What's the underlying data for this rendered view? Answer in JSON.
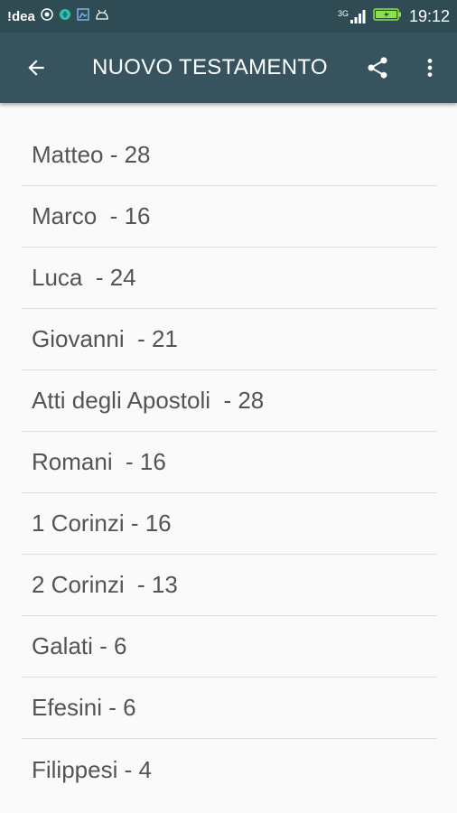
{
  "status_bar": {
    "carrier": "!dea",
    "network": "3G",
    "time": "19:12"
  },
  "toolbar": {
    "title": "NUOVO TESTAMENTO",
    "back_icon": "arrow-back-icon",
    "share_icon": "share-icon",
    "more_icon": "more-vert-icon"
  },
  "books": [
    {
      "label": "Matteo - 28"
    },
    {
      "label": "Marco  - 16"
    },
    {
      "label": "Luca  - 24"
    },
    {
      "label": "Giovanni  - 21"
    },
    {
      "label": "Atti degli Apostoli  - 28"
    },
    {
      "label": "Romani  - 16"
    },
    {
      "label": "1 Corinzi - 16"
    },
    {
      "label": "2 Corinzi  - 13"
    },
    {
      "label": "Galati - 6"
    },
    {
      "label": "Efesini - 6"
    },
    {
      "label": "Filippesi - 4"
    }
  ],
  "colors": {
    "status_bar": "#2f4b54",
    "toolbar": "#37545e",
    "background": "#fafafa",
    "text": "#545454",
    "divider": "#e0e0e0"
  }
}
